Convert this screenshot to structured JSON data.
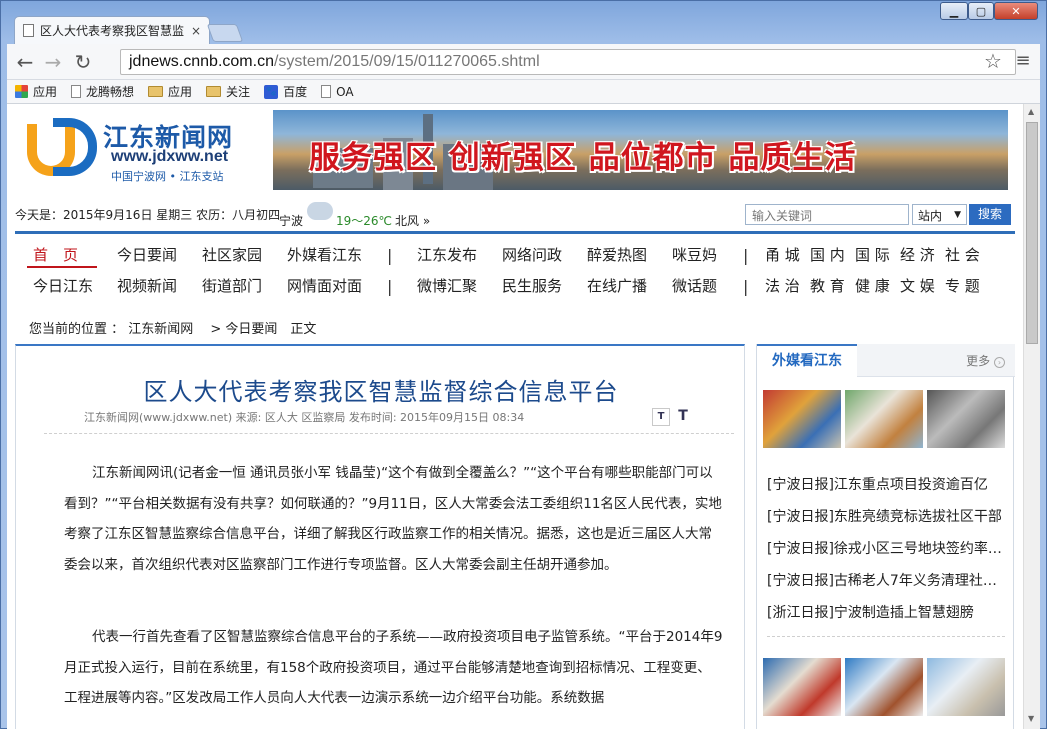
{
  "browser": {
    "tab_title": "区人大代表考察我区智慧监",
    "tab_close": "×",
    "url_host": "jdnews.cnnb.com.cn",
    "url_path": "/system/2015/09/15/011270065.shtml",
    "bookmarks": [
      "应用",
      "龙腾畅想",
      "应用",
      "关注",
      "百度",
      "OA"
    ]
  },
  "header": {
    "site_name": "江东新闻网",
    "site_url": "www.jdxww.net",
    "site_sub": "中国宁波网 • 江东支站",
    "banner_slogan": "服务强区 创新强区 品位都市 品质生活"
  },
  "infobar": {
    "date": "今天是：2015年9月16日  星期三  农历：八月初四",
    "city": "宁波",
    "temp": "19～26℃",
    "wind": "北风 »",
    "search_placeholder": "输入关键词",
    "scope": "站内",
    "search_btn": "搜索"
  },
  "nav": {
    "row1": [
      "首　页",
      "今日要闻",
      "社区家园",
      "外媒看江东",
      "江东发布",
      "网络问政",
      "醉爱热图",
      "咪豆妈",
      "甬 城",
      "国 内",
      "国 际",
      "经 济",
      "社 会"
    ],
    "row2": [
      "今日江东",
      "视频新闻",
      "街道部门",
      "网情面对面",
      "微博汇聚",
      "民生服务",
      "在线广播",
      "微话题",
      "法 治",
      "教 育",
      "健 康",
      "文 娱",
      "专 题"
    ],
    "sep": "|"
  },
  "breadcrumb": "您当前的位置 ： 江东新闻网  　>  今日要闻　正文",
  "article": {
    "title": "区人大代表考察我区智慧监督综合信息平台",
    "meta": "江东新闻网(www.jdxww.net)  来源:  区人大 区监察局    发布时间:  2015年09月15日 08:34",
    "font_small": "T",
    "font_large": "T",
    "p1": "江东新闻网讯(记者金一恒 通讯员张小军 钱晶莹)“这个有做到全覆盖么？”“这个平台有哪些职能部门可以看到？”“平台相关数据有没有共享？如何联通的？”9月11日，区人大常委会法工委组织11名区人民代表，实地考察了江东区智慧监察综合信息平台，详细了解我区行政监察工作的相关情况。据悉，这也是近三届区人大常委会以来，首次组织代表对区监察部门工作进行专项监督。区人大常委会副主任胡开通参加。",
    "p2": "代表一行首先查看了区智慧监察综合信息平台的子系统——政府投资项目电子监管系统。“平台于2014年9月正式投入运行，目前在系统里，有158个政府投资项目，通过平台能够清楚地查询到招标情况、工程变更、工程进展等内容。”区发改局工作人员向人大代表一边演示系统一边介绍平台功能。系统数据"
  },
  "sidebar": {
    "title": "外媒看江东",
    "more": "更多",
    "items": [
      "[宁波日报]江东重点项目投资逾百亿",
      "[宁波日报]东胜亮绩竞标选拔社区干部",
      "[宁波日报]徐戎小区三号地块签约率…",
      "[宁波日报]古稀老人7年义务清理社…",
      "[浙江日报]宁波制造插上智慧翅膀"
    ]
  }
}
